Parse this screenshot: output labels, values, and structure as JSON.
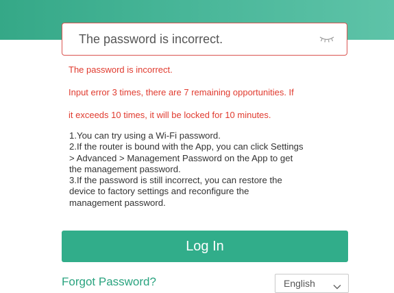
{
  "password_field": {
    "value": "The password is incorrect.",
    "toggle_icon": "eye-closed-icon"
  },
  "errors": {
    "line1": "The password is incorrect.",
    "line2": "Input error 3 times, there are 7 remaining opportunities. If",
    "line3": "it exceeds 10 times, it will be locked for 10 minutes."
  },
  "tips": [
    "1.You can try using a Wi-Fi password.",
    "2.If the router is bound with the App, you can click Settings",
    "> Advanced > Management Password on the App to get",
    "the management password.",
    "3.If the password is still incorrect, you can restore the",
    "device to factory settings and reconfigure the",
    "management password."
  ],
  "login_button": {
    "label": "Log In"
  },
  "forgot_link": {
    "label": "Forgot Password?"
  },
  "language": {
    "selected": "English",
    "icon": "chevron-down-icon"
  },
  "colors": {
    "accent": "#31ad8a",
    "error": "#e03a2e",
    "link": "#2aa37f"
  }
}
